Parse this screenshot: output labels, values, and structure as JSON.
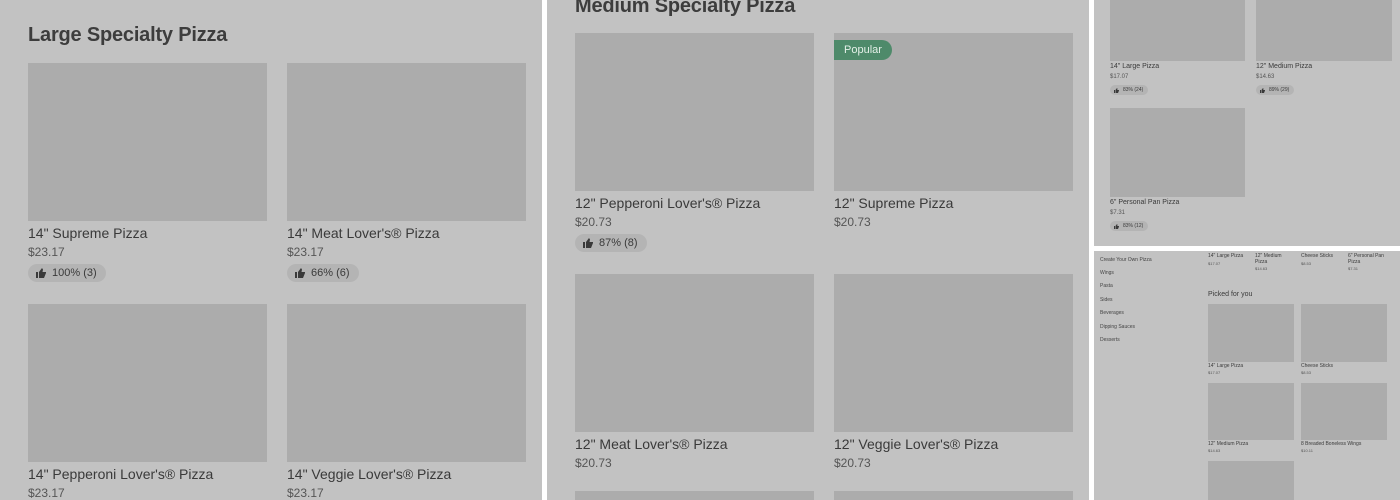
{
  "colors": {
    "panel_bg": "#c2c2c2",
    "placeholder": "#acacac",
    "popular_badge": "#4e8a6a",
    "rating_chip": "#b4b4b4"
  },
  "large": {
    "title": "Large Specialty Pizza",
    "items": [
      {
        "name": "14\" Supreme Pizza",
        "price": "$23.17",
        "rating": "100% (3)"
      },
      {
        "name": "14\" Meat Lover's® Pizza",
        "price": "$23.17",
        "rating": "66% (6)"
      },
      {
        "name": "14\" Pepperoni Lover's® Pizza",
        "price": "$23.17"
      },
      {
        "name": "14\" Veggie Lover's® Pizza",
        "price": "$23.17"
      }
    ]
  },
  "medium": {
    "title": "Medium Specialty Pizza",
    "popular_badge": "Popular",
    "items": [
      {
        "name": "12\" Pepperoni Lover's® Pizza",
        "price": "$20.73",
        "rating": "87% (8)"
      },
      {
        "name": "12\" Supreme Pizza",
        "price": "$20.73"
      },
      {
        "name": "12\" Meat Lover's® Pizza",
        "price": "$20.73"
      },
      {
        "name": "12\" Veggie Lover's® Pizza",
        "price": "$20.73"
      }
    ]
  },
  "thumb": {
    "items": [
      {
        "name": "14\" Large Pizza",
        "price": "$17.07",
        "rating": "83% (24)"
      },
      {
        "name": "12\" Medium Pizza",
        "price": "$14.63",
        "rating": "89% (29)"
      },
      {
        "name": "6\" Personal Pan Pizza",
        "price": "$7.31",
        "rating": "83% (12)"
      }
    ]
  },
  "mini": {
    "nav": [
      "Create Your Own Pizza",
      "Wings",
      "Pasta",
      "Sides",
      "Beverages",
      "Dipping Sauces",
      "Desserts"
    ],
    "top_items": [
      {
        "name": "14\" Large Pizza",
        "price": "$17.07"
      },
      {
        "name": "12\" Medium Pizza",
        "price": "$14.63"
      },
      {
        "name": "Cheese Sticks",
        "price": "$8.53"
      },
      {
        "name": "6\" Personal Pan Pizza",
        "price": "$7.31"
      }
    ],
    "picked_title": "Picked for you",
    "picked_items": [
      {
        "name": "14\" Large Pizza",
        "price": "$17.07"
      },
      {
        "name": "Cheese Sticks",
        "price": "$8.53"
      },
      {
        "name": "12\" Medium Pizza",
        "price": "$14.63"
      },
      {
        "name": "8 Breaded Boneless Wings",
        "price": "$10.11"
      }
    ]
  }
}
